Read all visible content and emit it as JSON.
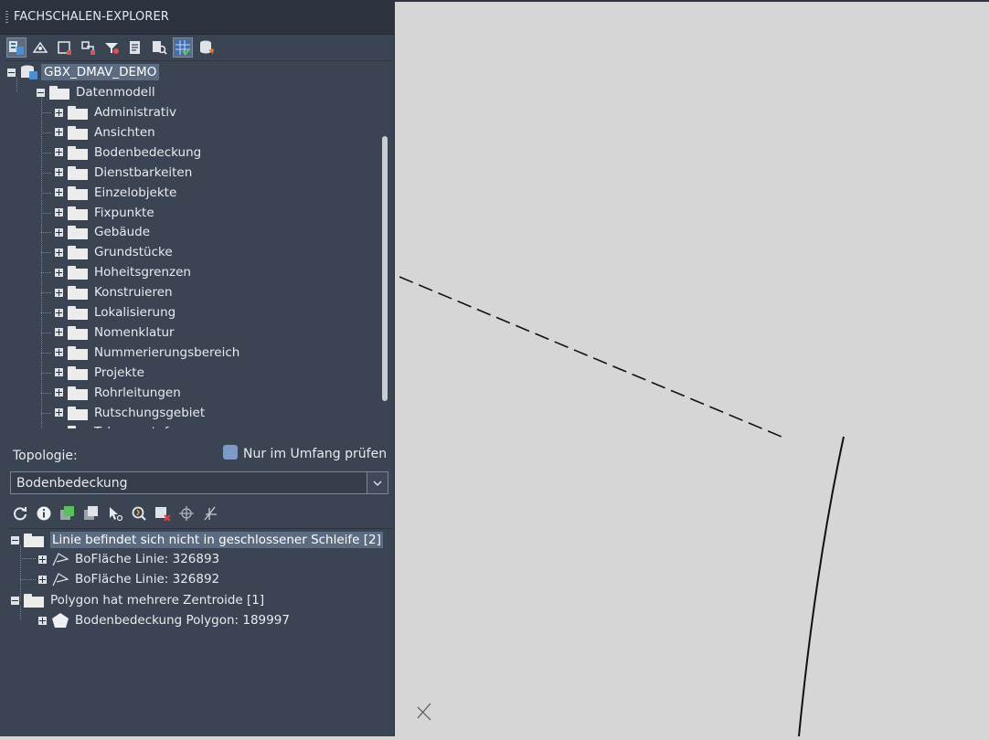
{
  "panel": {
    "title": "FACHSCHALEN-EXPLORER",
    "toolbar_icons": [
      "database-icon",
      "navigate-icon",
      "select-rectangle-icon",
      "select-polygon-icon",
      "filter-icon",
      "report-icon",
      "search-icon",
      "grid-check-icon",
      "database-stack-icon"
    ]
  },
  "tree": {
    "root": "GBX_DMAV_DEMO",
    "model": "Datenmodell",
    "topics": [
      "Administrativ",
      "Ansichten",
      "Bodenbedeckung",
      "Dienstbarkeiten",
      "Einzelobjekte",
      "Fixpunkte",
      "Gebäude",
      "Grundstücke",
      "Hoheitsgrenzen",
      "Konstruieren",
      "Lokalisierung",
      "Nomenklatur",
      "Nummerierungsbereich",
      "Projekte",
      "Rohrleitungen",
      "Rutschungsgebiet",
      "Toleranzstufe"
    ]
  },
  "topology": {
    "label": "Topologie:",
    "checkbox_label": "Nur im Umfang prüfen",
    "selected": "Bodenbedeckung",
    "toolbar_icons": [
      "refresh-icon",
      "info-icon",
      "layers-green-icon",
      "layers-gray-icon",
      "select-cursor-icon",
      "zoom-icon",
      "delete-error-icon",
      "snap-target-icon",
      "split-icon"
    ]
  },
  "results": {
    "group1": "Linie befindet sich nicht in geschlossener Schleife [2]",
    "group1_items": [
      "BoFläche Linie: 326893",
      "BoFläche Linie: 326892"
    ],
    "group2": "Polygon hat mehrere Zentroide [1]",
    "group2_items": [
      "Bodenbedeckung Polygon: 189997"
    ]
  },
  "colors": {
    "panel_bg": "#3b4453",
    "canvas_bg": "#d6d6d6",
    "highlight": "#5a6b82"
  }
}
